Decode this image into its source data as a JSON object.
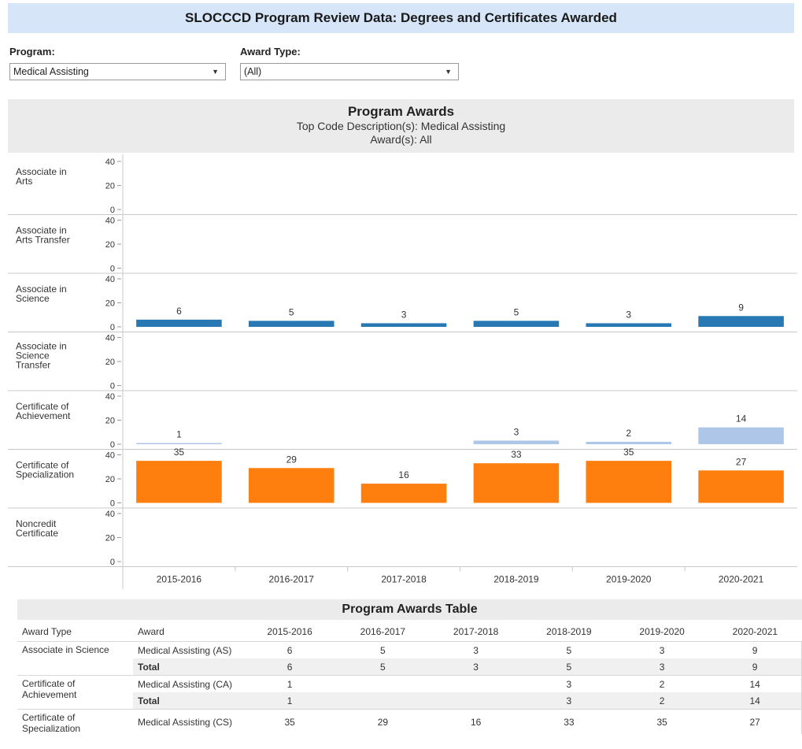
{
  "page": {
    "title": "SLOCCCD Program Review Data: Degrees and Certificates Awarded"
  },
  "filters": {
    "program_label": "Program:",
    "program_value": "Medical Assisting",
    "award_label": "Award Type:",
    "award_value": "(All)"
  },
  "chart_header": {
    "title": "Program Awards",
    "line1": "Top Code Description(s): Medical Assisting",
    "line2": "Award(s): All"
  },
  "colors": {
    "associate_in_science": "#2878b4",
    "certificate_of_achievement": "#aec7e8",
    "certificate_of_specialization": "#ff7f0e",
    "header_bg": "#ebebeb",
    "title_bg": "#d6e6f8"
  },
  "chart_data": {
    "type": "bar",
    "title": "Program Awards",
    "categories": [
      "2015-2016",
      "2016-2017",
      "2017-2018",
      "2018-2019",
      "2019-2020",
      "2020-2021"
    ],
    "ylim": [
      0,
      40
    ],
    "yticks": [
      "40",
      "20",
      "0"
    ],
    "grid": false,
    "rows": [
      {
        "name": "Associate in Arts",
        "label_lines": [
          "Associate in",
          "Arts"
        ],
        "color": "#2878b4",
        "values": [
          null,
          null,
          null,
          null,
          null,
          null
        ]
      },
      {
        "name": "Associate in Arts Transfer",
        "label_lines": [
          "Associate in",
          "Arts Transfer"
        ],
        "color": "#2878b4",
        "values": [
          null,
          null,
          null,
          null,
          null,
          null
        ]
      },
      {
        "name": "Associate in Science",
        "label_lines": [
          "Associate in",
          "Science"
        ],
        "color": "#2878b4",
        "values": [
          6,
          5,
          3,
          5,
          3,
          9
        ]
      },
      {
        "name": "Associate in Science Transfer",
        "label_lines": [
          "Associate in",
          "Science",
          "Transfer"
        ],
        "color": "#2878b4",
        "values": [
          null,
          null,
          null,
          null,
          null,
          null
        ]
      },
      {
        "name": "Certificate of Achievement",
        "label_lines": [
          "Certificate of",
          "Achievement"
        ],
        "color": "#aec7e8",
        "values": [
          1,
          null,
          null,
          3,
          2,
          14
        ]
      },
      {
        "name": "Certificate of Specialization",
        "label_lines": [
          "Certificate of",
          "Specialization"
        ],
        "color": "#ff7f0e",
        "values": [
          35,
          29,
          16,
          33,
          35,
          27
        ]
      },
      {
        "name": "Noncredit Certificate",
        "label_lines": [
          "Noncredit",
          "Certificate"
        ],
        "color": "#2878b4",
        "values": [
          null,
          null,
          null,
          null,
          null,
          null
        ]
      }
    ]
  },
  "table": {
    "title": "Program Awards Table",
    "headers": [
      "Award Type",
      "Award",
      "2015-2016",
      "2016-2017",
      "2017-2018",
      "2018-2019",
      "2019-2020",
      "2020-2021"
    ],
    "groups": [
      {
        "type_lines": [
          "Associate in Science"
        ],
        "rows": [
          {
            "award": "Medical Assisting (AS)",
            "total": false,
            "values": [
              "6",
              "5",
              "3",
              "5",
              "3",
              "9"
            ]
          },
          {
            "award": "Total",
            "total": true,
            "values": [
              "6",
              "5",
              "3",
              "5",
              "3",
              "9"
            ]
          }
        ]
      },
      {
        "type_lines": [
          "Certificate of",
          "Achievement"
        ],
        "rows": [
          {
            "award": "Medical Assisting (CA)",
            "total": false,
            "values": [
              "1",
              "",
              "",
              "3",
              "2",
              "14"
            ]
          },
          {
            "award": "Total",
            "total": true,
            "values": [
              "1",
              "",
              "",
              "3",
              "2",
              "14"
            ]
          }
        ]
      },
      {
        "type_lines": [
          "Certificate of",
          "Specialization"
        ],
        "rows": [
          {
            "award": "Medical Assisting (CS)",
            "total": false,
            "values": [
              "35",
              "29",
              "16",
              "33",
              "35",
              "27"
            ]
          }
        ]
      }
    ]
  }
}
